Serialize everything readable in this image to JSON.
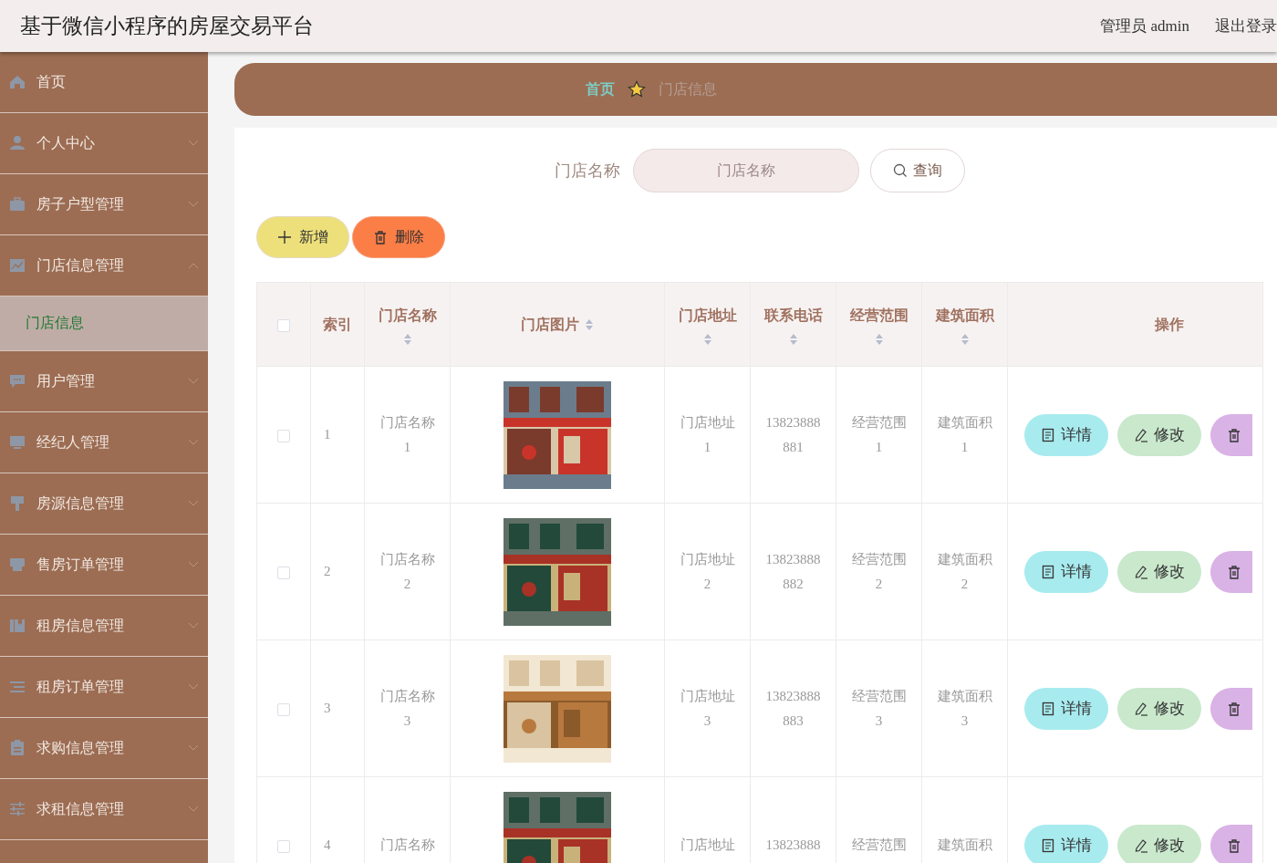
{
  "header": {
    "title": "基于微信小程序的房屋交易平台",
    "user": "管理员 admin",
    "logout": "退出登录"
  },
  "sidebar": {
    "items": [
      {
        "label": "首页",
        "kind": "link"
      },
      {
        "label": "个人中心",
        "kind": "group",
        "expanded": false
      },
      {
        "label": "房子户型管理",
        "kind": "group",
        "expanded": false
      },
      {
        "label": "门店信息管理",
        "kind": "group",
        "expanded": true,
        "children": [
          {
            "label": "门店信息",
            "selected": true
          }
        ]
      },
      {
        "label": "用户管理",
        "kind": "group",
        "expanded": false
      },
      {
        "label": "经纪人管理",
        "kind": "group",
        "expanded": false
      },
      {
        "label": "房源信息管理",
        "kind": "group",
        "expanded": false
      },
      {
        "label": "售房订单管理",
        "kind": "group",
        "expanded": false
      },
      {
        "label": "租房信息管理",
        "kind": "group",
        "expanded": false
      },
      {
        "label": "租房订单管理",
        "kind": "group",
        "expanded": false
      },
      {
        "label": "求购信息管理",
        "kind": "group",
        "expanded": false
      },
      {
        "label": "求租信息管理",
        "kind": "group",
        "expanded": false
      }
    ]
  },
  "breadcrumb": {
    "items": [
      {
        "label": "首页",
        "selected": false
      },
      {
        "label": "门店信息",
        "selected": true
      }
    ]
  },
  "search": {
    "label": "门店名称",
    "placeholder": "门店名称",
    "button": "查询"
  },
  "actions": [
    {
      "label": "新增",
      "kind": "add"
    },
    {
      "label": "删除",
      "kind": "delete"
    }
  ],
  "table": {
    "select_all": {
      "checked": false
    },
    "columns": [
      {
        "label": "索引",
        "sortable": false
      },
      {
        "label": "门店名称",
        "sortable": true
      },
      {
        "label": "门店图片",
        "sortable": true
      },
      {
        "label": "门店地址",
        "sortable": true
      },
      {
        "label": "联系电话",
        "sortable": true
      },
      {
        "label": "经营范围",
        "sortable": true
      },
      {
        "label": "建筑面积",
        "sortable": true
      },
      {
        "label": "操作",
        "sortable": false
      }
    ],
    "rows": [
      {
        "checked": false,
        "index": "1",
        "name": "门店名称1",
        "image": {
          "kind": "picture"
        },
        "address": "门店地址1",
        "phone": "13823888881",
        "scope": "经营范围1",
        "area": "建筑面积1",
        "buttons": [
          {
            "label": "详情",
            "kind": "detail"
          },
          {
            "label": "修改",
            "kind": "edit"
          },
          {
            "kind": "delete"
          }
        ]
      },
      {
        "checked": false,
        "index": "2",
        "name": "门店名称2",
        "image": {
          "kind": "picture"
        },
        "address": "门店地址2",
        "phone": "13823888882",
        "scope": "经营范围2",
        "area": "建筑面积2",
        "buttons": [
          {
            "label": "详情",
            "kind": "detail"
          },
          {
            "label": "修改",
            "kind": "edit"
          },
          {
            "kind": "delete"
          }
        ]
      },
      {
        "checked": false,
        "index": "3",
        "name": "门店名称3",
        "image": {
          "kind": "picture"
        },
        "address": "门店地址3",
        "phone": "13823888883",
        "scope": "经营范围3",
        "area": "建筑面积3",
        "buttons": [
          {
            "label": "详情",
            "kind": "detail"
          },
          {
            "label": "修改",
            "kind": "edit"
          },
          {
            "kind": "delete"
          }
        ]
      },
      {
        "checked": false,
        "index": "4",
        "name": "门店名称",
        "image": {
          "kind": "picture"
        },
        "address": "门店地址",
        "phone": "13823888",
        "scope": "经营范围",
        "area": "建筑面积",
        "buttons": [
          {
            "label": "详情",
            "kind": "detail"
          },
          {
            "label": "修改",
            "kind": "edit"
          },
          {
            "kind": "delete"
          }
        ]
      }
    ]
  }
}
